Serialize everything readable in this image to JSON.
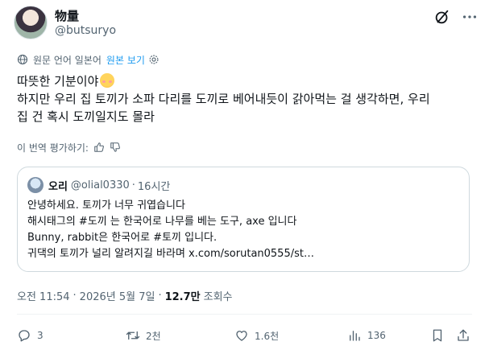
{
  "author": {
    "display_name": "物量",
    "handle": "@butsuryo"
  },
  "translation_bar": {
    "source_note": "원문 언어 일본어",
    "show_original": "원본 보기"
  },
  "tweet": {
    "line1": "따뜻한 기분이야",
    "line2": "하지만 우리 집 토끼가 소파 다리를 도끼로 베어내듯이 갉아먹는 걸 생각하면, 우리",
    "line3": "집 건 혹시 도끼일지도 몰라"
  },
  "rate_translation": "이 번역 평가하기:",
  "quote": {
    "display_name": "오리",
    "handle": "@olial0330",
    "separator": "·",
    "time": "16시간",
    "lines": [
      "안녕하세요. 토끼가 너무 귀엽습니다",
      "해시태그의 #도끼  는 한국어로 나무를 베는 도구, axe 입니다",
      "Bunny, rabbit은 한국어로 #토끼 입니다.",
      "귀댁의 토끼가 널리 알려지길 바라며 x.com/sorutan0555/st…"
    ]
  },
  "meta": {
    "time": "오전 11:54",
    "date": "2026년 5월 7일",
    "dot": "·",
    "views_count": "12.7만",
    "views_label": "조회수"
  },
  "actions": {
    "replies": "3",
    "retweets": "2천",
    "likes": "1.6천",
    "views": "136"
  },
  "colors": {
    "accent": "#1d9bf0",
    "secondary_text": "#536471",
    "primary_text": "#0f1419",
    "border": "#cfd9de"
  },
  "icons": [
    "grok-icon",
    "more-icon",
    "globe-icon",
    "gear-icon",
    "thumbs-up-icon",
    "thumbs-down-icon",
    "reply-icon",
    "retweet-icon",
    "like-icon",
    "views-icon",
    "bookmark-icon",
    "share-icon"
  ]
}
